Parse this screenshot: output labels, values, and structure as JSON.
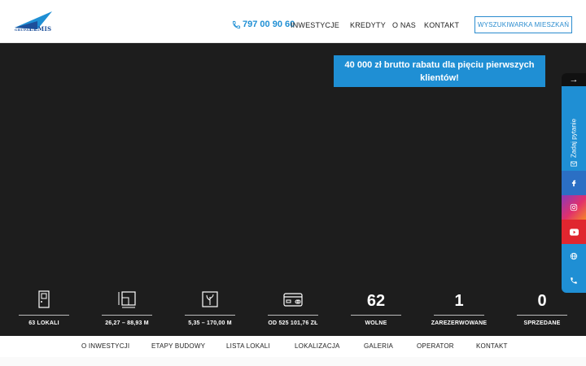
{
  "brand": {
    "logo_text": "ELMIS",
    "logo_small": "GRUPA",
    "logo_icon": "triangle-wing-logo",
    "color": "#1d4f9a"
  },
  "header": {
    "phone": "797 00 90 60",
    "nav": [
      "INWESTYCJE",
      "KREDYTY",
      "O NAS",
      "KONTAKT"
    ],
    "search_button": "WYSZUKIWARKA MIESZKAŃ",
    "accent": "#1f8fd4"
  },
  "promo": {
    "text": "40 000 zł brutto rabatu dla pięciu pierwszych klientów!"
  },
  "side": {
    "arrow": "→",
    "ask_label": "Zadaj pytanie",
    "buttons": [
      "facebook-icon",
      "instagram-icon",
      "youtube-icon",
      "globe-icon",
      "phone-icon"
    ]
  },
  "stats": [
    {
      "kind": "icon",
      "icon": "door-icon",
      "label": "63 LOKALI"
    },
    {
      "kind": "icon",
      "icon": "area-icon",
      "label": "26,27 – 88,93 M"
    },
    {
      "kind": "icon",
      "icon": "plot-icon",
      "label": "5,35 – 170,00 M"
    },
    {
      "kind": "icon",
      "icon": "credit-card-icon",
      "label": "OD 525 101,76 ZŁ"
    },
    {
      "kind": "number",
      "value": "62",
      "label": "WOLNE"
    },
    {
      "kind": "number",
      "value": "1",
      "label": "ZAREZERWOWANE"
    },
    {
      "kind": "number",
      "value": "0",
      "label": "SPRZEDANE"
    }
  ],
  "bottom_nav": [
    "O INWESTYCJI",
    "ETAPY BUDOWY",
    "LISTA LOKALI",
    "LOKALIZACJA",
    "GALERIA",
    "OPERATOR",
    "KONTAKT"
  ]
}
